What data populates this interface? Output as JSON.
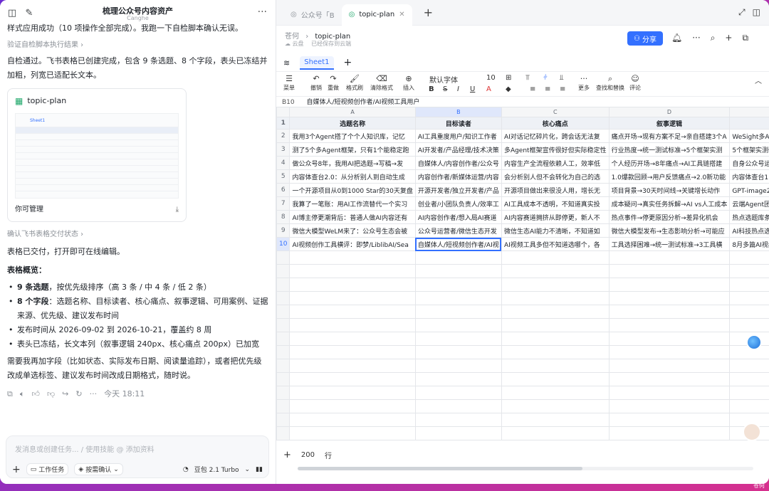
{
  "left": {
    "title": "梳理公众号内容资产",
    "subtitle": "Canghe",
    "messages": {
      "top_line": "样式应用成功（10 项操作全部完成）。我跑一下自检脚本确认无误。",
      "step1": "验证自检脚本执行结果 ›",
      "para1": "自检通过。飞书表格已创建完成，包含 9 条选题、8 个字段，表头已冻结并加粗，列宽已适配长文本。",
      "step2": "确认飞书表格交付状态 ›",
      "para2": "表格已交付，打开即可在线编辑。",
      "overview_title": "表格概览：",
      "bullets": [
        {
          "bold": "9 条选题",
          "text": "，按优先级排序（高 3 条 / 中 4 条 / 低 2 条）"
        },
        {
          "bold": "8 个字段",
          "text": "：选题名称、目标读者、核心痛点、叙事逻辑、可用案例、证据来源、优先级、建议发布时间"
        },
        {
          "bold": "",
          "text": "发布时间从 2026-09-02 到 2026-10-21，覆盖约 8 周"
        },
        {
          "bold": "",
          "text": "表头已冻结，长文本列（叙事逻辑 240px、核心痛点 200px）已加宽"
        }
      ],
      "para3": "需要我再加字段（比如状态、实际发布日期、阅读量追踪），或者把优先级改成单选标签、建议发布时间改成日期格式，随时说。",
      "timestamp": "今天 18:11"
    },
    "card": {
      "name": "topic-plan",
      "mini_tab": "Sheet1",
      "permission": "你可管理"
    },
    "input": {
      "placeholder": "发消息或创建任务... / 使用技能 @ 添加资料",
      "chip1": "工作任务",
      "chip2": "按需确认",
      "model": "豆包 2.1 Turbo"
    }
  },
  "right": {
    "tabs": [
      {
        "label": "公众号「B"
      },
      {
        "label": "topic-plan"
      }
    ],
    "breadcrumb": {
      "root": "苍何",
      "current": "topic-plan",
      "location": "云盘",
      "status": "已经保存到云端"
    },
    "share_label": "分享",
    "sheet_tab": "Sheet1",
    "toolbar": {
      "menu": "菜单",
      "undo": "撤销",
      "redo": "重做",
      "format_painter": "格式刷",
      "clear_format": "清除格式",
      "insert": "插入",
      "font": "默认字体",
      "size": "10",
      "more": "更多",
      "find_replace": "查找和替换",
      "comment": "评论"
    },
    "formula_ref": "B10",
    "formula_value": "自媒体人/短视频创作者/AI视频工具用户",
    "columns": [
      "A",
      "B",
      "C",
      "D",
      "E"
    ],
    "headers": [
      "选题名称",
      "目标读者",
      "核心痛点",
      "叙事逻辑",
      "可用案例"
    ],
    "rows": [
      [
        "我用3个Agent搭了个个人知识库，记忆",
        "AI工具重度用户/知识工作者",
        "AI对话记忆碎片化，跨会话无法复",
        "痛点开场→现有方案不足→亲自搭建3个A",
        "WeSight多Agent架构，个人知"
      ],
      [
        "测了5个多Agent框架，只有1个能稳定跑",
        "AI开发者/产品经理/技术决策",
        "多Agent框架宣传很好但实际稳定性",
        "行业热度→统一测试标准→5个框架实测",
        "5个框架实测任务测试（含失败"
      ],
      [
        "做公众号8年，我用AI把选题→写稿→发",
        "自媒体人/内容创作者/公众号",
        "内容生产全流程依赖人工，效率低",
        "个人经历开场→8年痛点→AI工具链搭建",
        "自身公众号运营数据、QClaw测"
      ],
      [
        "内容体查台2.0：从分析别人到自动生成",
        "内容创作者/新媒体运营/内容",
        "会分析别人但不会转化为自己的选",
        "1.0爆款回顾→用户反馈痛点→2.0新功能",
        "内容体查台1.0（1.8w阅读）、1"
      ],
      [
        "一个开源项目从0到1000 Star的30天复盘",
        "开源开发者/独立开发者/产品",
        "开源项目做出来很没人用，增长无",
        "项目背景→30天时间线→关键增长动作",
        "GPT-image2（12天4.2K Star）G"
      ],
      [
        "我算了一笔账：用AI工作流替代一个实习",
        "创业者/小团队负责人/效率工",
        "AI工具成本不透明，不知道真实投",
        "成本疑问→真实任务拆解→AI vs人工成本",
        "云端Agent团队（每月省一千）to"
      ],
      [
        "AI博主停更潮背后：普通人做AI内容还有",
        "AI内容创作者/想入局AI赛道",
        "AI内容赛道拥挤从即停更，新人不",
        "热点事件→停更原因分析→差异化机会",
        "热点选题库条目、自身账号定位"
      ],
      [
        "微信大模型WeLM来了：公众号生态会被",
        "公众号运营者/微信生态开发",
        "微信生态AI能力不清晰，不知道如",
        "微信大模型发布→生态影响分析→可能应",
        "AI科技热点选题库条目、微信工"
      ],
      [
        "AI视频创作工具横评：即梦/LiblibAI/Sea",
        "自媒体人/短视频创作者/AI视",
        "AI视频工具多但不知道选哪个，各",
        "工具选择困难→统一测试标准→3工具横",
        "8月多篇AI视频草稿（即梦3.5p"
      ]
    ],
    "footer_rows": "200",
    "footer_rows_unit": "行"
  }
}
